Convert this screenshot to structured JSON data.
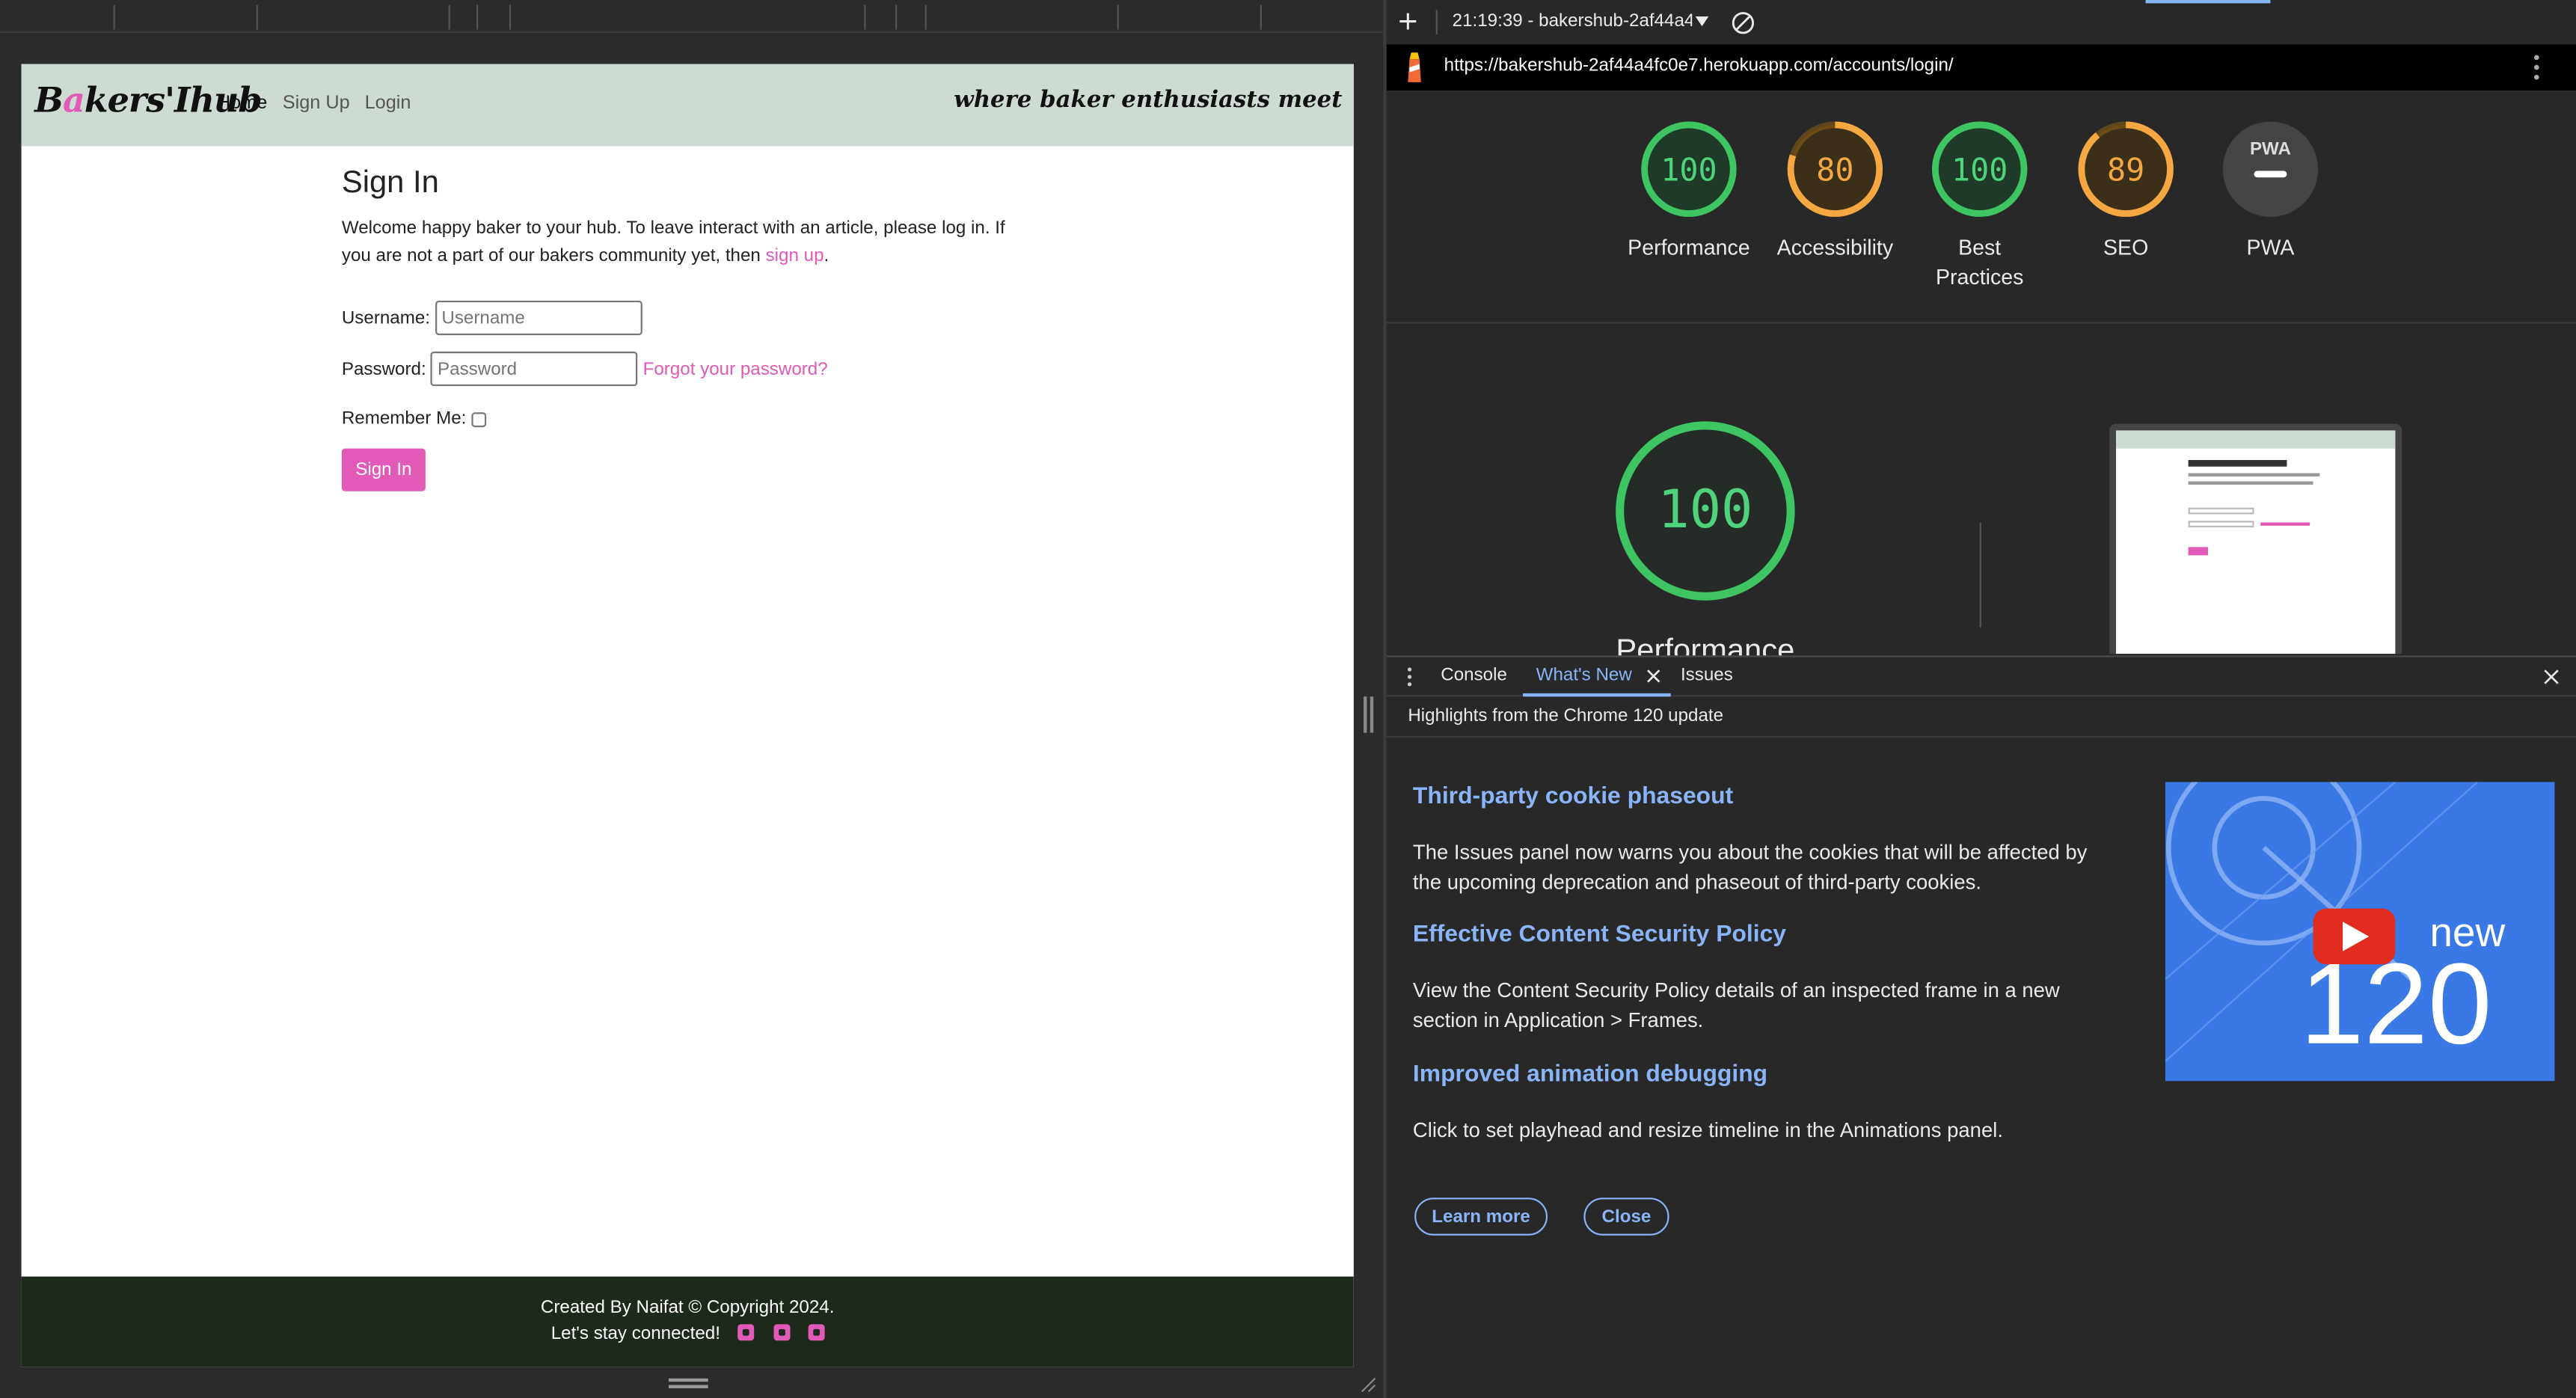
{
  "site": {
    "logo_pre": "B",
    "logo_pink": "a",
    "logo_post": "kers'Ihub",
    "nav": [
      "Home",
      "Sign Up",
      "Login"
    ],
    "tagline": "where baker enthusiasts meet",
    "signin_title": "Sign In",
    "welcome_text": "Welcome happy baker to your hub. To leave interact with an article, please log in. If you are not a part of our bakers community yet, then ",
    "signup_link": "sign up",
    "welcome_end": ".",
    "username_label": "Username:",
    "username_placeholder": "Username",
    "password_label": "Password:",
    "password_placeholder": "Password",
    "forgot_link": "Forgot your password?",
    "remember_label": "Remember Me:",
    "remember_checked": false,
    "signin_button": "Sign In",
    "footer_line1": "Created By Naifat © Copyright 2024.",
    "footer_line2": "Let's stay connected!",
    "social_icons": [
      "facebook-icon",
      "twitter-icon",
      "instagram-icon"
    ],
    "pink": "#e25ab8"
  },
  "devtools": {
    "timestamp": "21:19:39 - bakershub-2af44a4",
    "url": "https://bakershub-2af44a4fc0e7.herokuapp.com/accounts/login/",
    "scores": [
      {
        "value": "100",
        "label": "Performance",
        "color": "#0cce6b",
        "fraction": 1.0
      },
      {
        "value": "80",
        "label": "Accessibility",
        "color": "#ffa400",
        "fraction": 0.8
      },
      {
        "value": "100",
        "label": "Best Practices",
        "color": "#0cce6b",
        "fraction": 1.0
      },
      {
        "value": "89",
        "label": "SEO",
        "color": "#ffa400",
        "fraction": 0.89
      },
      {
        "value": "PWA",
        "label": "PWA",
        "color": "#444",
        "fraction": 0
      }
    ],
    "big_score": "100",
    "big_label": "Performance",
    "tabs": [
      "Console",
      "What's New",
      "Issues"
    ],
    "active_tab": "What's New",
    "highlights": "Highlights from the Chrome 120 update",
    "features": [
      {
        "title": "Third-party cookie phaseout",
        "body": "The Issues panel now warns you about the cookies that will be affected by the upcoming deprecation and phaseout of third-party cookies."
      },
      {
        "title": "Effective Content Security Policy",
        "body": "View the Content Security Policy details of an inspected frame in a new section in Application > Frames."
      },
      {
        "title": "Improved animation debugging",
        "body": "Click to set playhead and resize timeline in the Animations panel."
      }
    ],
    "learn_more": "Learn more",
    "close": "Close",
    "promo_new": "new",
    "promo_version": "120"
  }
}
